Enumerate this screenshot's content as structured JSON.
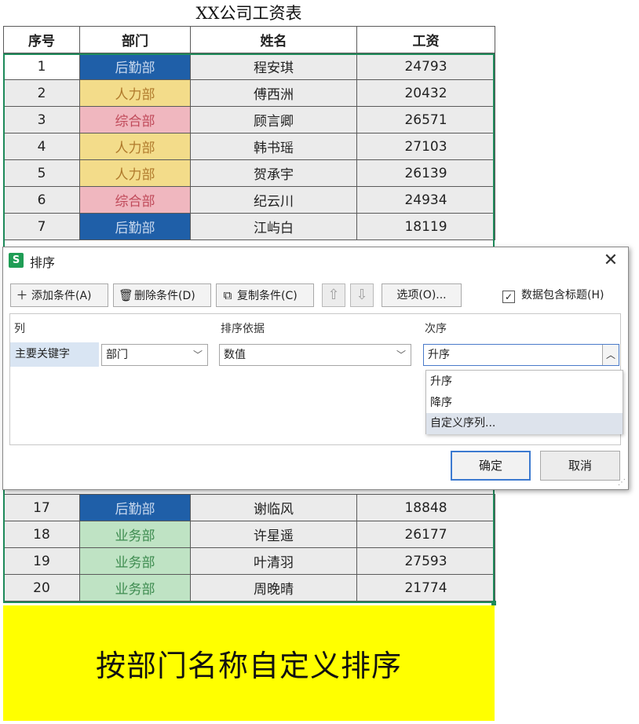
{
  "sheet": {
    "title": "XX公司工资表",
    "headers": [
      "序号",
      "部门",
      "姓名",
      "工资"
    ],
    "rows_top": [
      {
        "num": "1",
        "dept": "后勤部",
        "name": "程安琪",
        "salary": "24793"
      },
      {
        "num": "2",
        "dept": "人力部",
        "name": "傅西洲",
        "salary": "20432"
      },
      {
        "num": "3",
        "dept": "综合部",
        "name": "顾言卿",
        "salary": "26571"
      },
      {
        "num": "4",
        "dept": "人力部",
        "name": "韩书瑶",
        "salary": "27103"
      },
      {
        "num": "5",
        "dept": "人力部",
        "name": "贺承宇",
        "salary": "26139"
      },
      {
        "num": "6",
        "dept": "综合部",
        "name": "纪云川",
        "salary": "24934"
      },
      {
        "num": "7",
        "dept": "后勤部",
        "name": "江屿白",
        "salary": "18119"
      }
    ],
    "rows_bottom": [
      {
        "num": "17",
        "dept": "后勤部",
        "name": "谢临风",
        "salary": "18848"
      },
      {
        "num": "18",
        "dept": "业务部",
        "name": "许星遥",
        "salary": "26177"
      },
      {
        "num": "19",
        "dept": "业务部",
        "name": "叶清羽",
        "salary": "27593"
      },
      {
        "num": "20",
        "dept": "业务部",
        "name": "周晚晴",
        "salary": "21774"
      }
    ],
    "dept_colors": {
      "后勤部": {
        "bg": "#1f5fa8",
        "fg": "#c8d8ee"
      },
      "人力部": {
        "bg": "#f3dc8a",
        "fg": "#b07a2c"
      },
      "综合部": {
        "bg": "#f0b7bf",
        "fg": "#c04a5a"
      },
      "业务部": {
        "bg": "#bfe3c4",
        "fg": "#3d8b4f"
      }
    },
    "selection_color": "#1e8a5a"
  },
  "banner": {
    "text": "按部门名称自定义排序",
    "bg": "#ffff00"
  },
  "dialog": {
    "app_icon_letter": "S",
    "title": "排序",
    "close_icon": "close-icon",
    "toolbar": {
      "add": "添加条件(A)",
      "delete": "删除条件(D)",
      "copy": "复制条件(C)",
      "move_up_icon": "arrow-up-icon",
      "move_down_icon": "arrow-down-icon",
      "options": "选项(O)...",
      "has_header_label": "数据包含标题(H)",
      "has_header_checked": true
    },
    "grid": {
      "col_column": "列",
      "col_sort_on": "排序依据",
      "col_order": "次序",
      "row_label": "主要关键字",
      "column_value": "部门",
      "sort_on_value": "数值",
      "order_value": "升序"
    },
    "dropdown": [
      "升序",
      "降序",
      "自定义序列..."
    ],
    "ok": "确定",
    "cancel": "取消"
  }
}
